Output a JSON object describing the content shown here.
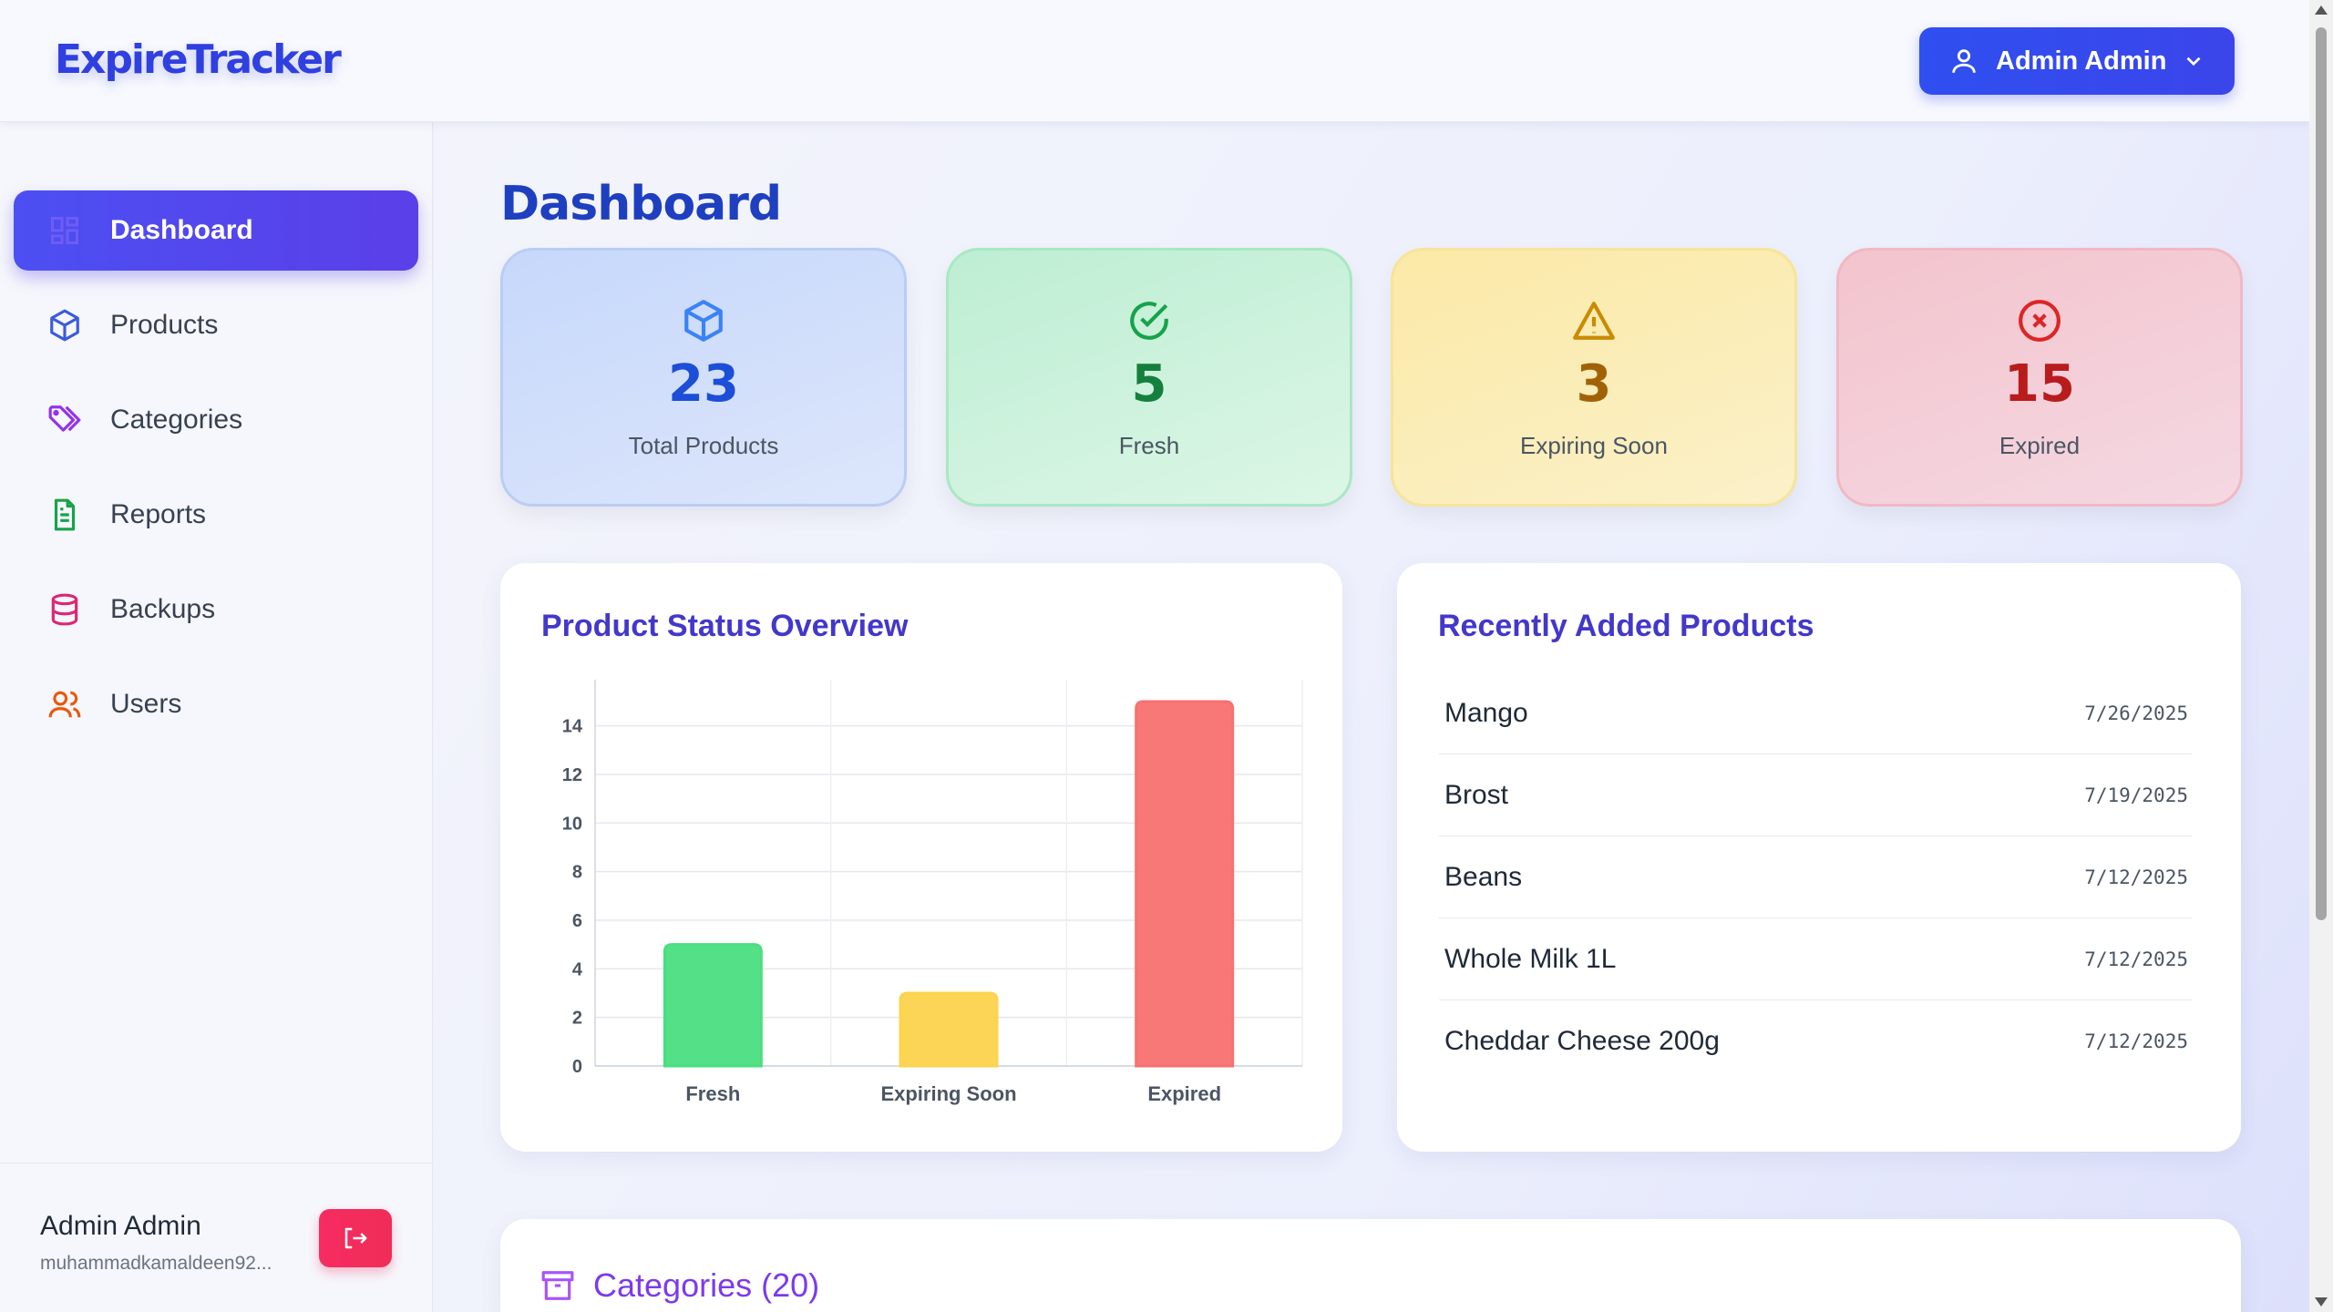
{
  "app": {
    "logo": "ExpireTracker"
  },
  "header": {
    "user_label": "Admin Admin"
  },
  "sidebar": {
    "items": [
      {
        "label": "Dashboard",
        "icon": "grid-icon",
        "active": true
      },
      {
        "label": "Products",
        "icon": "cube-icon"
      },
      {
        "label": "Categories",
        "icon": "tags-icon"
      },
      {
        "label": "Reports",
        "icon": "document-icon"
      },
      {
        "label": "Backups",
        "icon": "database-icon"
      },
      {
        "label": "Users",
        "icon": "users-icon"
      }
    ],
    "footer": {
      "name": "Admin Admin",
      "email": "muhammadkamaldeen92..."
    }
  },
  "main": {
    "title": "Dashboard",
    "stats": [
      {
        "value": "23",
        "label": "Total Products",
        "icon": "cube-icon",
        "color": "#1d4ed8"
      },
      {
        "value": "5",
        "label": "Fresh",
        "icon": "check-circle-icon",
        "color": "#16a34a"
      },
      {
        "value": "3",
        "label": "Expiring Soon",
        "icon": "warning-icon",
        "color": "#ca8a04"
      },
      {
        "value": "15",
        "label": "Expired",
        "icon": "x-circle-icon",
        "color": "#dc2626"
      }
    ],
    "chart_title": "Product Status Overview",
    "recent_title": "Recently Added Products",
    "recent": [
      {
        "name": "Mango",
        "date": "7/26/2025"
      },
      {
        "name": "Brost",
        "date": "7/19/2025"
      },
      {
        "name": "Beans",
        "date": "7/12/2025"
      },
      {
        "name": "Whole Milk 1L",
        "date": "7/12/2025"
      },
      {
        "name": "Cheddar Cheese 200g",
        "date": "7/12/2025"
      }
    ],
    "categories_title": "Categories (20)"
  },
  "chart_data": {
    "type": "bar",
    "title": "Product Status Overview",
    "categories": [
      "Fresh",
      "Expiring Soon",
      "Expired"
    ],
    "values": [
      5,
      3,
      15
    ],
    "colors": [
      "#4ade80",
      "#fcd34d",
      "#f87171"
    ],
    "ylim": [
      0,
      15
    ],
    "yticks": [
      0,
      2,
      4,
      6,
      8,
      10,
      12,
      14
    ],
    "grid": true,
    "legend": "none"
  }
}
